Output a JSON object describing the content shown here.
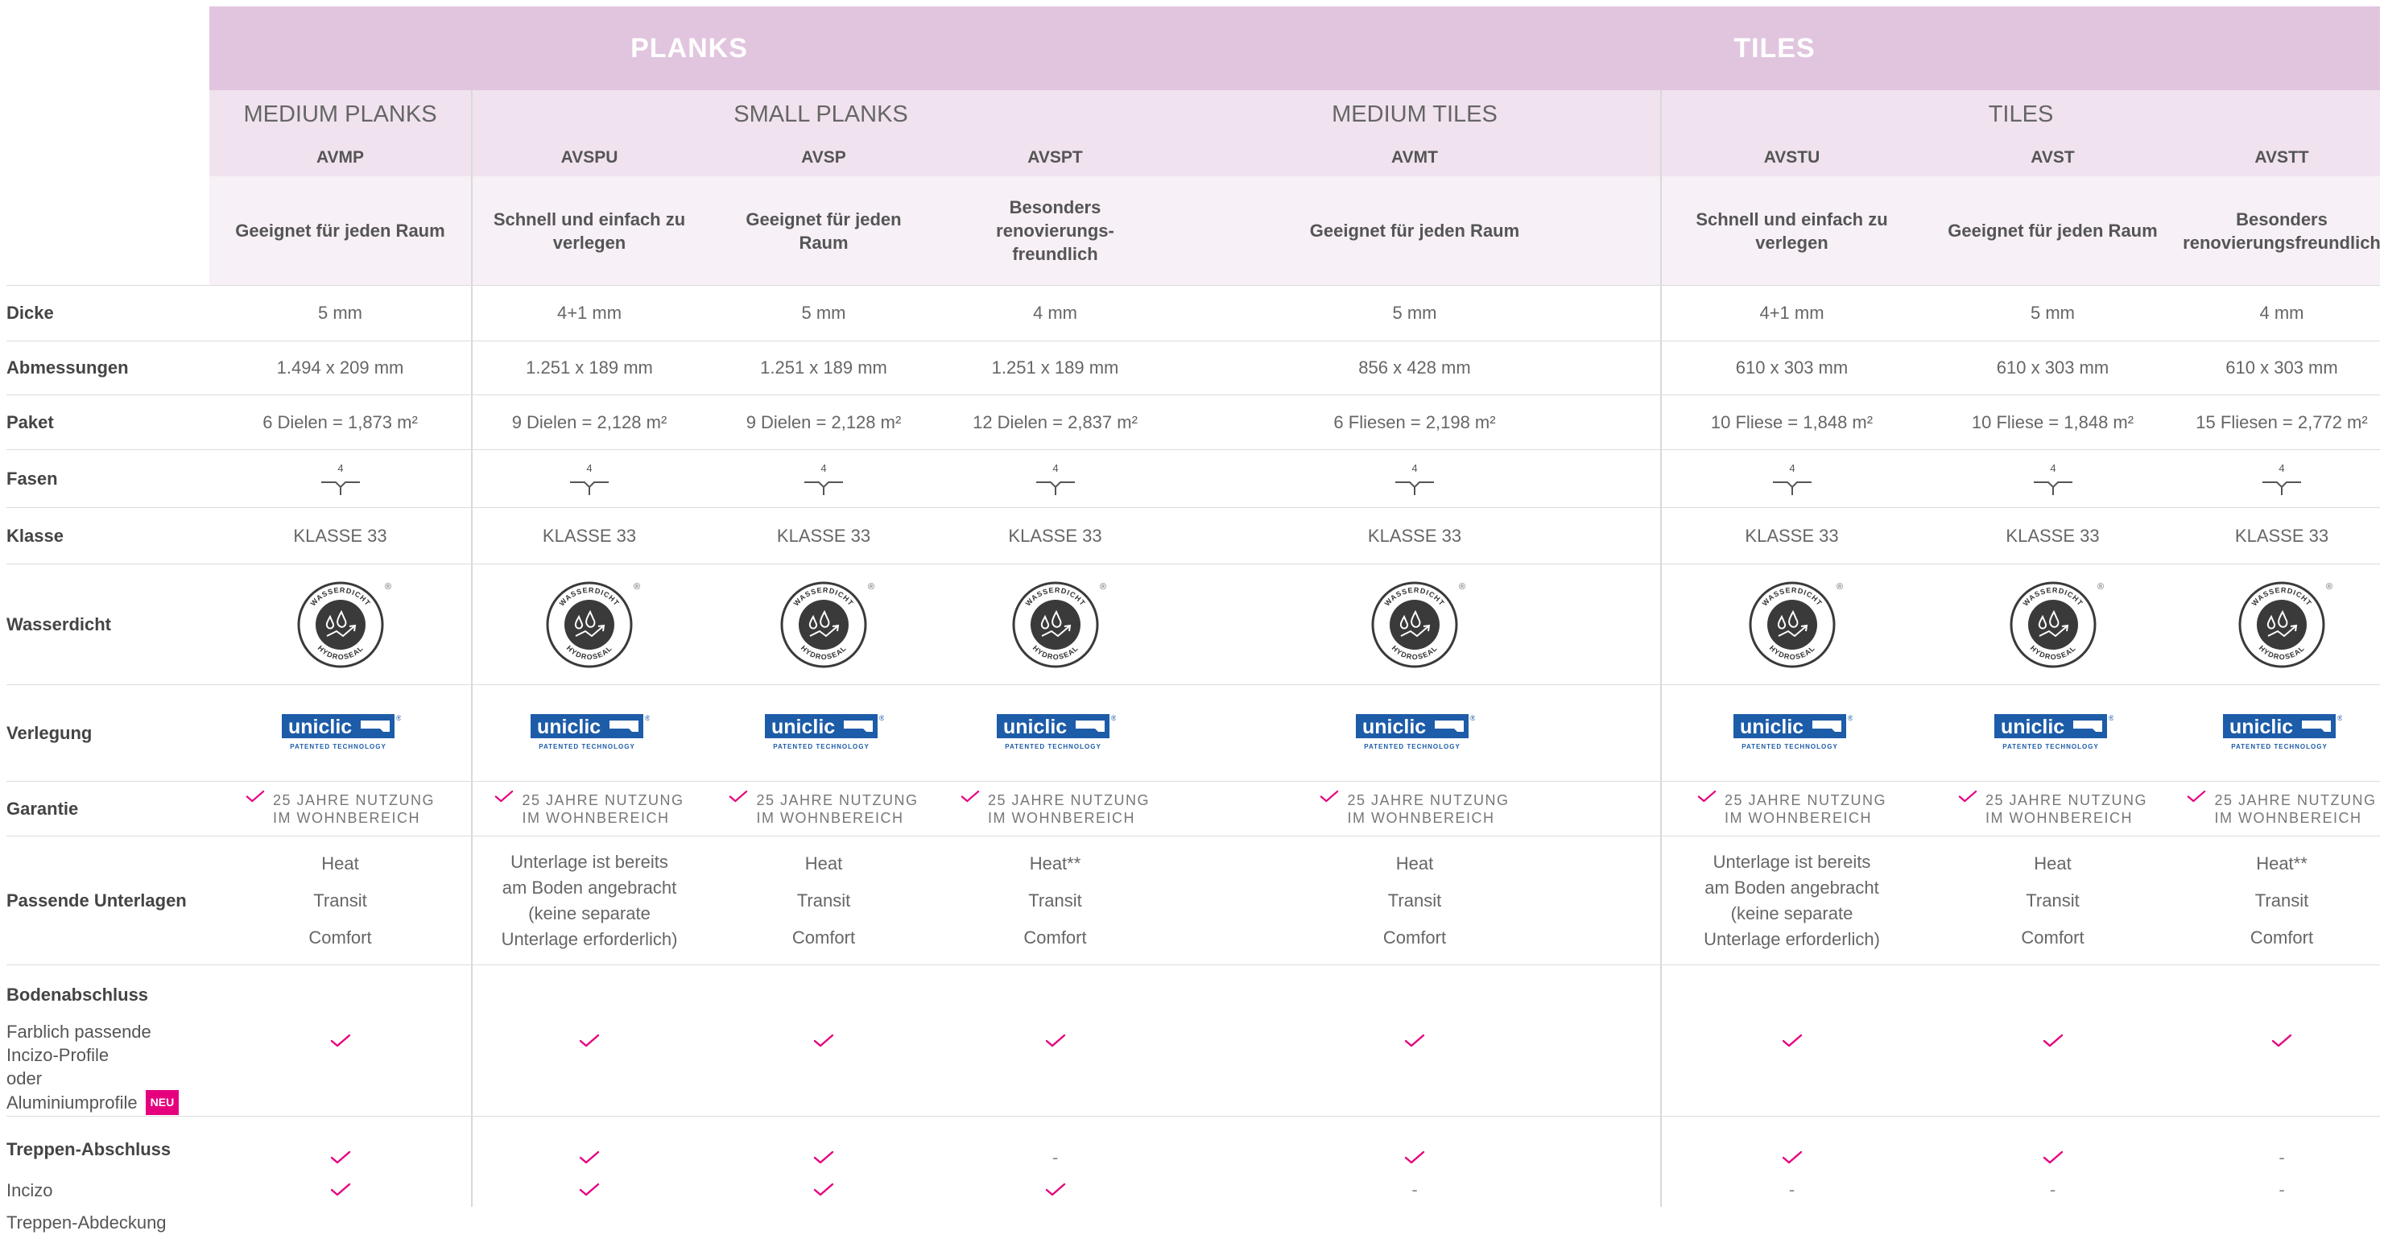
{
  "header": {
    "planks_title": "PLANKS",
    "tiles_title": "TILES",
    "sub": {
      "medium_planks": "MEDIUM PLANKS",
      "small_planks": "SMALL PLANKS",
      "medium_tiles": "MEDIUM TILES",
      "tiles": "TILES"
    }
  },
  "products": [
    {
      "code": "AVMP",
      "description": "Geeignet für jeden Raum",
      "dicke": "5 mm",
      "abmessungen": "1.494 x 209 mm",
      "paket": "6 Dielen = 1,873 m²",
      "klasse": "KLASSE 33",
      "unterlagen": [
        "Heat",
        "Transit",
        "Comfort"
      ],
      "bodenabschluss": "check",
      "incizo": "check",
      "treppen_abdeckung": "check"
    },
    {
      "code": "AVSPU",
      "description": "Schnell und einfach zu verlegen",
      "dicke": "4+1 mm",
      "abmessungen": "1.251 x 189 mm",
      "paket": "9 Dielen = 2,128 m²",
      "klasse": "KLASSE 33",
      "unterlagen": [
        "Unterlage ist bereits",
        "am Boden angebracht",
        "(keine separate",
        "Unterlage erforderlich)"
      ],
      "bodenabschluss": "check",
      "incizo": "check",
      "treppen_abdeckung": "check"
    },
    {
      "code": "AVSP",
      "description": "Geeignet für jeden Raum",
      "dicke": "5 mm",
      "abmessungen": "1.251 x 189 mm",
      "paket": "9 Dielen = 2,128 m²",
      "klasse": "KLASSE 33",
      "unterlagen": [
        "Heat",
        "Transit",
        "Comfort"
      ],
      "bodenabschluss": "check",
      "incizo": "check",
      "treppen_abdeckung": "check"
    },
    {
      "code": "AVSPT",
      "description": "Besonders renovierungs-freundlich",
      "dicke": "4 mm",
      "abmessungen": "1.251 x 189 mm",
      "paket": "12 Dielen = 2,837 m²",
      "klasse": "KLASSE 33",
      "unterlagen": [
        "Heat**",
        "Transit",
        "Comfort"
      ],
      "bodenabschluss": "check",
      "incizo": "-",
      "treppen_abdeckung": "check"
    },
    {
      "code": "AVMT",
      "description": "Geeignet für jeden Raum",
      "dicke": "5 mm",
      "abmessungen": "856 x 428 mm",
      "paket": "6 Fliesen = 2,198 m²",
      "klasse": "KLASSE 33",
      "unterlagen": [
        "Heat",
        "Transit",
        "Comfort"
      ],
      "bodenabschluss": "check",
      "incizo": "check",
      "treppen_abdeckung": "-"
    },
    {
      "code": "AVSTU",
      "description": "Schnell und einfach zu verlegen",
      "dicke": "4+1 mm",
      "abmessungen": "610 x 303 mm",
      "paket": "10 Fliese = 1,848 m²",
      "klasse": "KLASSE 33",
      "unterlagen": [
        "Unterlage ist bereits",
        "am Boden angebracht",
        "(keine separate",
        "Unterlage erforderlich)"
      ],
      "bodenabschluss": "check",
      "incizo": "check",
      "treppen_abdeckung": "-"
    },
    {
      "code": "AVST",
      "description": "Geeignet für jeden Raum",
      "dicke": "5 mm",
      "abmessungen": "610 x 303 mm",
      "paket": "10 Fliese = 1,848 m²",
      "klasse": "KLASSE 33",
      "unterlagen": [
        "Heat",
        "Transit",
        "Comfort"
      ],
      "bodenabschluss": "check",
      "incizo": "check",
      "treppen_abdeckung": "-"
    },
    {
      "code": "AVSTT",
      "description": "Besonders renovierungsfreundlich",
      "dicke": "4 mm",
      "abmessungen": "610 x 303 mm",
      "paket": "15 Fliesen = 2,772 m²",
      "klasse": "KLASSE 33",
      "unterlagen": [
        "Heat**",
        "Transit",
        "Comfort"
      ],
      "bodenabschluss": "check",
      "incizo": "-",
      "treppen_abdeckung": "-"
    }
  ],
  "row_labels": {
    "dicke": "Dicke",
    "abmessungen": "Abmessungen",
    "paket": "Paket",
    "fasen": "Fasen",
    "klasse": "Klasse",
    "wasserdicht": "Wasserdicht",
    "verlegung": "Verlegung",
    "garantie": "Garantie",
    "unterlagen": "Passende Unterlagen"
  },
  "bodenabschluss": {
    "title": "Bodenabschluss",
    "lines": [
      "Farblich passende",
      "Incizo-Profile",
      "oder",
      "Aluminiumprofile"
    ],
    "badge": "NEU"
  },
  "treppen": {
    "title": "Treppen-Abschluss",
    "incizo": "Incizo",
    "abdeckung": "Treppen-Abdeckung"
  },
  "fasen_icon": {
    "name": "bevel-4-icon",
    "number": "4"
  },
  "seal": {
    "top": "WASSERDICHT",
    "bottom": "HYDROSEAL",
    "mark": "®"
  },
  "uniclic": {
    "word": "uniclic",
    "tagline": "PATENTED TECHNOLOGY",
    "mark": "®"
  },
  "garantie": {
    "line1": "25 JAHRE NUTZUNG",
    "line2": "IM WOHNBEREICH"
  },
  "colors": {
    "band": "#e1c5df",
    "subband": "#f0e3ef",
    "descband": "#f7f0f6",
    "check": "#e6007e",
    "uniclic_blue": "#1d5ca8",
    "seal_dark": "#3a3a3a"
  }
}
